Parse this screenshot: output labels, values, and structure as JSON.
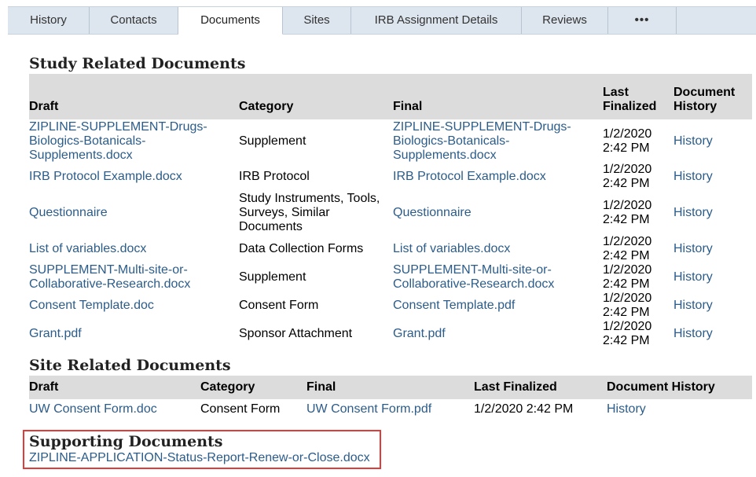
{
  "tabs": [
    {
      "label": "History",
      "active": false
    },
    {
      "label": "Contacts",
      "active": false
    },
    {
      "label": "Documents",
      "active": true
    },
    {
      "label": "Sites",
      "active": false
    },
    {
      "label": "IRB Assignment Details",
      "active": false
    },
    {
      "label": "Reviews",
      "active": false
    },
    {
      "label": "•••",
      "active": false
    }
  ],
  "study_docs": {
    "title": "Study Related Documents",
    "headers": {
      "draft": "Draft",
      "category": "Category",
      "final": "Final",
      "last_finalized_1": "Last",
      "last_finalized_2": "Finalized",
      "history_1": "Document",
      "history_2": "History"
    },
    "rows": [
      {
        "draft_lines": [
          "ZIPLINE-SUPPLEMENT-Drugs-",
          "Biologics-Botanicals-",
          "Supplements.docx"
        ],
        "category_lines": [
          "Supplement"
        ],
        "final_lines": [
          "ZIPLINE-SUPPLEMENT-Drugs-",
          "Biologics-Botanicals-",
          "Supplements.docx"
        ],
        "date": "1/2/2020",
        "time": "2:42 PM",
        "history": "History"
      },
      {
        "draft_lines": [
          "IRB Protocol Example.docx"
        ],
        "category_lines": [
          "IRB Protocol"
        ],
        "final_lines": [
          "IRB Protocol Example.docx"
        ],
        "date": "1/2/2020",
        "time": "2:42 PM",
        "history": "History"
      },
      {
        "draft_lines": [
          "Questionnaire"
        ],
        "category_lines": [
          "Study Instruments, Tools,",
          "Surveys, Similar",
          "Documents"
        ],
        "final_lines": [
          "Questionnaire"
        ],
        "date": "1/2/2020",
        "time": "2:42 PM",
        "history": "History"
      },
      {
        "draft_lines": [
          "List of variables.docx"
        ],
        "category_lines": [
          "Data Collection Forms"
        ],
        "final_lines": [
          "List of variables.docx"
        ],
        "date": "1/2/2020",
        "time": "2:42 PM",
        "history": "History"
      },
      {
        "draft_lines": [
          "SUPPLEMENT-Multi-site-or-",
          "Collaborative-Research.docx"
        ],
        "category_lines": [
          "Supplement"
        ],
        "final_lines": [
          "SUPPLEMENT-Multi-site-or-",
          "Collaborative-Research.docx"
        ],
        "date": "1/2/2020",
        "time": "2:42 PM",
        "history": "History"
      },
      {
        "draft_lines": [
          "Consent Template.doc"
        ],
        "category_lines": [
          "Consent Form"
        ],
        "final_lines": [
          "Consent Template.pdf"
        ],
        "date": "1/2/2020",
        "time": "2:42 PM",
        "history": "History"
      },
      {
        "draft_lines": [
          "Grant.pdf"
        ],
        "category_lines": [
          "Sponsor Attachment"
        ],
        "final_lines": [
          "Grant.pdf"
        ],
        "date": "1/2/2020",
        "time": "2:42 PM",
        "history": "History"
      }
    ]
  },
  "site_docs": {
    "title": "Site Related Documents",
    "headers": {
      "draft": "Draft",
      "category": "Category",
      "final": "Final",
      "last_finalized": "Last Finalized",
      "history": "Document History"
    },
    "rows": [
      {
        "draft": "UW Consent Form.doc",
        "category": "Consent Form",
        "final": "UW Consent Form.pdf",
        "last_finalized": "1/2/2020 2:42 PM",
        "history": "History"
      }
    ]
  },
  "supporting_docs": {
    "title": "Supporting Documents",
    "link": "ZIPLINE-APPLICATION-Status-Report-Renew-or-Close.docx",
    "highlight_color": "#e03c3c"
  },
  "colors": {
    "link": "#2b5c8a",
    "header_bg": "#dcdcdc",
    "tabbar_bg": "#dde5ee"
  }
}
